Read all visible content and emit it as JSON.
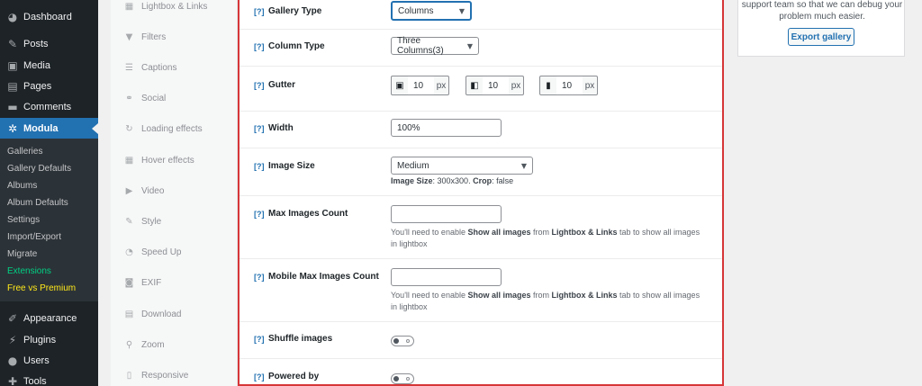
{
  "wp_menu": {
    "items": [
      {
        "label": "Dashboard",
        "icon": "dashboard-icon",
        "glyph": "◕"
      },
      {
        "label": "Posts",
        "icon": "pin-icon",
        "glyph": "✎"
      },
      {
        "label": "Media",
        "icon": "media-icon",
        "glyph": "▣"
      },
      {
        "label": "Pages",
        "icon": "pages-icon",
        "glyph": "▤"
      },
      {
        "label": "Comments",
        "icon": "comments-icon",
        "glyph": "▬"
      },
      {
        "label": "Modula",
        "icon": "gear-icon",
        "glyph": "✲"
      },
      {
        "label": "Appearance",
        "icon": "brush-icon",
        "glyph": "✐"
      },
      {
        "label": "Plugins",
        "icon": "plugin-icon",
        "glyph": "⚡"
      },
      {
        "label": "Users",
        "icon": "user-icon",
        "glyph": "●"
      },
      {
        "label": "Tools",
        "icon": "wrench-icon",
        "glyph": "✚"
      }
    ],
    "submenu": [
      "Galleries",
      "Gallery Defaults",
      "Albums",
      "Album Defaults",
      "Settings",
      "Import/Export",
      "Migrate",
      "Extensions",
      "Free vs Premium"
    ],
    "colors": {
      "active": "#2271b1",
      "extensions": "#00d084",
      "premium": "#ffe81a"
    }
  },
  "modula_tabs": [
    {
      "label": "Lightbox & Links",
      "icon": "lightbox-icon",
      "glyph": "▦"
    },
    {
      "label": "Filters",
      "icon": "filter-icon",
      "glyph": "▼"
    },
    {
      "label": "Captions",
      "icon": "captions-icon",
      "glyph": "☰"
    },
    {
      "label": "Social",
      "icon": "share-icon",
      "glyph": "⚭"
    },
    {
      "label": "Loading effects",
      "icon": "loading-icon",
      "glyph": "↻"
    },
    {
      "label": "Hover effects",
      "icon": "hover-icon",
      "glyph": "▦"
    },
    {
      "label": "Video",
      "icon": "video-icon",
      "glyph": "▶"
    },
    {
      "label": "Style",
      "icon": "style-icon",
      "glyph": "✎"
    },
    {
      "label": "Speed Up",
      "icon": "speed-icon",
      "glyph": "◔"
    },
    {
      "label": "EXIF",
      "icon": "camera-icon",
      "glyph": "◙"
    },
    {
      "label": "Download",
      "icon": "download-icon",
      "glyph": "▤"
    },
    {
      "label": "Zoom",
      "icon": "zoom-icon",
      "glyph": "⚲"
    },
    {
      "label": "Responsive",
      "icon": "responsive-icon",
      "glyph": "▯"
    }
  ],
  "settings": {
    "help_marker": "[?]",
    "gallery_type": {
      "label": "Gallery Type",
      "value": "Columns"
    },
    "column_type": {
      "label": "Column Type",
      "value": "Three Columns(3)"
    },
    "gutter": {
      "label": "Gutter",
      "unit": "px",
      "desktop": "10",
      "tablet": "10",
      "mobile": "10"
    },
    "width": {
      "label": "Width",
      "value": "100%"
    },
    "image_size": {
      "label": "Image Size",
      "value": "Medium",
      "info_label": "Image Size",
      "info_value": ": 300x300. ",
      "crop_label": "Crop",
      "crop_value": ": false"
    },
    "max_images": {
      "label": "Max Images Count",
      "value": ""
    },
    "mobile_max_images": {
      "label": "Mobile Max Images Count",
      "value": ""
    },
    "lightbox_note": {
      "part1": "You'll need to enable ",
      "bold1": "Show all images",
      "part2": " from ",
      "bold2": "Lightbox & Links",
      "part3": " tab to show all images in lightbox"
    },
    "shuffle": {
      "label": "Shuffle images",
      "on": false
    },
    "powered_by": {
      "label": "Powered by",
      "on": false
    }
  },
  "support_box": {
    "line1": "support team so that we can debug your",
    "line2": "problem much easier.",
    "button": "Export gallery"
  }
}
